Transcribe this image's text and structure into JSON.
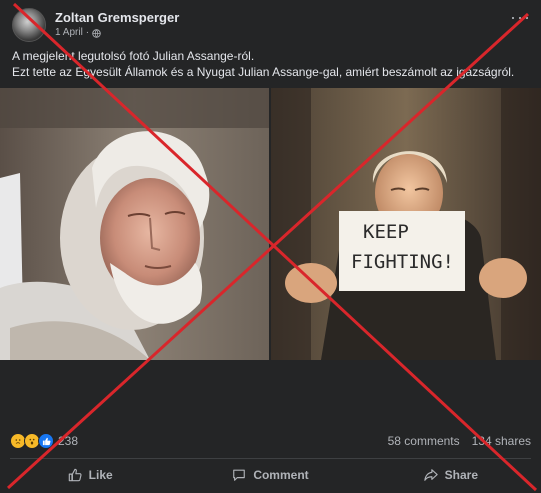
{
  "post": {
    "author": "Zoltan Gremsperger",
    "date": "1 April",
    "separator": "·",
    "text_lines": [
      "A megjelent legutolsó fotó Julian Assange-ról.",
      "Ezt tette az Egyesült Államok és a Nyugat Julian Assange-gal, amiért beszámolt az igazságról."
    ]
  },
  "photos": {
    "sign_line1": "KEEP",
    "sign_line2": "FIGHTING!"
  },
  "stats": {
    "reaction_icons": [
      "sad-reaction-icon",
      "wow-reaction-icon",
      "like-reaction-icon"
    ],
    "reaction_count": "238",
    "comments": "58 comments",
    "shares": "134 shares"
  },
  "actions": {
    "like": "Like",
    "comment": "Comment",
    "share": "Share"
  },
  "overlay": {
    "cross_color": "#d9262b"
  }
}
